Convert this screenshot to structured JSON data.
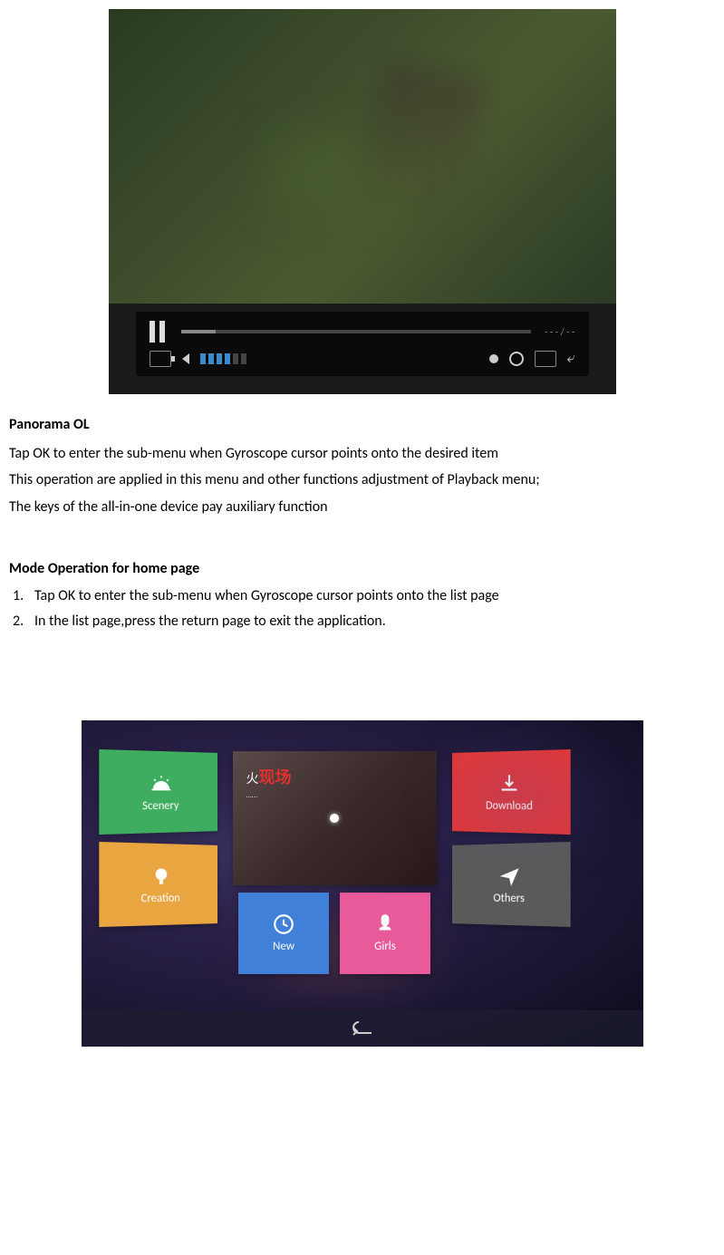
{
  "video": {
    "time_label": "- - - / - -"
  },
  "panorama": {
    "heading": "Panorama OL",
    "line1": "Tap OK to enter the sub-menu when Gyroscope cursor points onto the desired item",
    "line2": "This operation are applied in this menu and other functions adjustment of Playback menu;",
    "line3": "The keys of the all-in-one device pay auxiliary function"
  },
  "mode_op": {
    "heading": "Mode Operation for home page",
    "item1": "Tap OK to enter the sub-menu when Gyroscope cursor points onto the list page",
    "item2": "In the list page,press the return page to exit the application."
  },
  "tiles": {
    "scenery": "Scenery",
    "creation": "Creation",
    "download": "Download",
    "others": "Others",
    "new": "New",
    "girls": "Girls",
    "center_red": "现场",
    "center_sub": "……"
  }
}
